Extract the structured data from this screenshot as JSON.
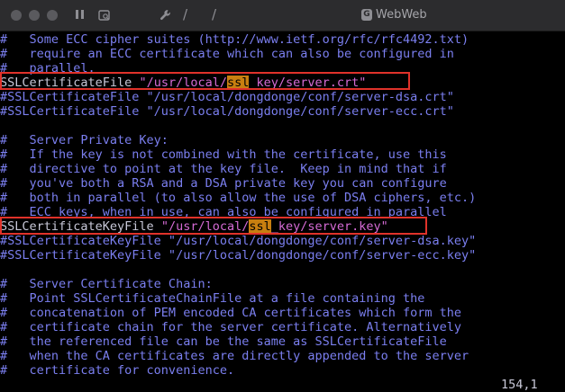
{
  "window": {
    "title": "WebWeb",
    "app_icon_glyph": "G"
  },
  "icons": {
    "sidebar": "sidebar-icon",
    "tab_overview": "tab-overview-icon",
    "tools": "wrench-icon"
  },
  "lines": [
    [
      {
        "t": "#   Some ECC cipher suites (http://www.ietf.org/rfc/rfc4492.txt)",
        "c": "cmt"
      }
    ],
    [
      {
        "t": "#   require an ECC certificate which can also be configured in",
        "c": "cmt"
      }
    ],
    [
      {
        "t": "#   parallel.",
        "c": "cmt"
      }
    ],
    [
      {
        "t": "SSLCertificateFile ",
        "c": "dir"
      },
      {
        "t": "\"/usr/local/",
        "c": "str"
      },
      {
        "t": "ssl",
        "c": "hl"
      },
      {
        "t": "_key/server.crt\"",
        "c": "str"
      }
    ],
    [
      {
        "t": "#SSLCertificateFile \"/usr/local/dongdonge/conf/server-dsa.crt\"",
        "c": "cmt"
      }
    ],
    [
      {
        "t": "#SSLCertificateFile \"/usr/local/dongdonge/conf/server-ecc.crt\"",
        "c": "cmt"
      }
    ],
    [
      {
        "t": "",
        "c": "cmt"
      }
    ],
    [
      {
        "t": "#   Server Private Key:",
        "c": "cmt"
      }
    ],
    [
      {
        "t": "#   If the key is not combined with the certificate, use this",
        "c": "cmt"
      }
    ],
    [
      {
        "t": "#   directive to point at the key file.  Keep in mind that if",
        "c": "cmt"
      }
    ],
    [
      {
        "t": "#   you've both a RSA and a DSA private key you can configure",
        "c": "cmt"
      }
    ],
    [
      {
        "t": "#   both in parallel (to also allow the use of DSA ciphers, etc.)",
        "c": "cmt"
      }
    ],
    [
      {
        "t": "#   ECC keys, when in use, can also be configured in parallel",
        "c": "cmt"
      }
    ],
    [
      {
        "t": "SSLCertificateKeyFile ",
        "c": "dir"
      },
      {
        "t": "\"/usr/local/",
        "c": "str"
      },
      {
        "t": "ssl",
        "c": "hl"
      },
      {
        "t": "_key/server.key\"",
        "c": "str"
      }
    ],
    [
      {
        "t": "#SSLCertificateKeyFile \"/usr/local/dongdonge/conf/server-dsa.key\"",
        "c": "cmt"
      }
    ],
    [
      {
        "t": "#SSLCertificateKeyFile \"/usr/local/dongdonge/conf/server-ecc.key\"",
        "c": "cmt"
      }
    ],
    [
      {
        "t": "",
        "c": "cmt"
      }
    ],
    [
      {
        "t": "#   Server Certificate Chain:",
        "c": "cmt"
      }
    ],
    [
      {
        "t": "#   Point SSLCertificateChainFile at a file containing the",
        "c": "cmt"
      }
    ],
    [
      {
        "t": "#   concatenation of PEM encoded CA certificates which form the",
        "c": "cmt"
      }
    ],
    [
      {
        "t": "#   certificate chain for the server certificate. Alternatively",
        "c": "cmt"
      }
    ],
    [
      {
        "t": "#   the referenced file can be the same as SSLCertificateFile",
        "c": "cmt"
      }
    ],
    [
      {
        "t": "#   when the CA certificates are directly appended to the server",
        "c": "cmt"
      }
    ],
    [
      {
        "t": "#   certificate for convenience.",
        "c": "cmt"
      }
    ]
  ],
  "status": {
    "position": "154,1"
  },
  "colors": {
    "comment": "#7b7ff0",
    "directive": "#c8c8d8",
    "string": "#d56bd5",
    "search_highlight": "#c87f10",
    "annotation_box": "#e0322a"
  }
}
